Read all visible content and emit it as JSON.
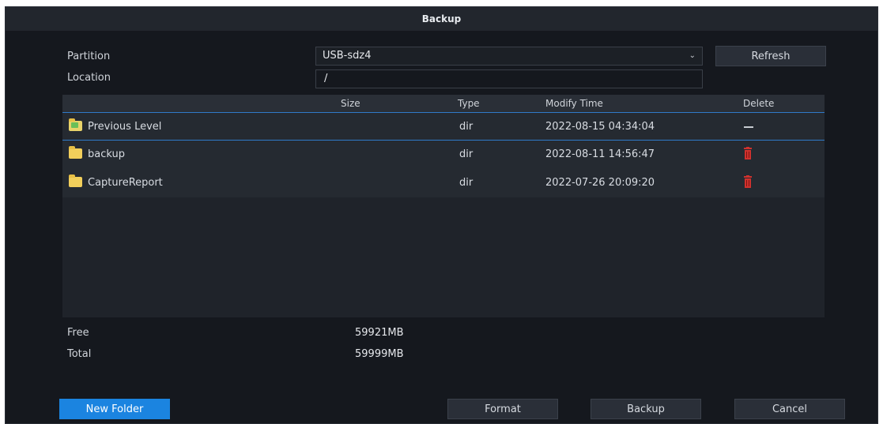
{
  "dialog": {
    "title": "Backup"
  },
  "form": {
    "partition_label": "Partition",
    "partition_value": "USB-sdz4",
    "location_label": "Location",
    "location_value": "/",
    "refresh_label": "Refresh"
  },
  "table": {
    "columns": [
      "Size",
      "Type",
      "Modify Time",
      "Delete"
    ],
    "rows": [
      {
        "name": "Previous Level",
        "size": "",
        "type": "dir",
        "modified": "2022-08-15 04:34:04",
        "delete": "none"
      },
      {
        "name": "backup",
        "size": "",
        "type": "dir",
        "modified": "2022-08-11 14:56:47",
        "delete": "trash-icon"
      },
      {
        "name": "CaptureReport",
        "size": "",
        "type": "dir",
        "modified": "2022-07-26 20:09:20",
        "delete": "trash-icon"
      }
    ]
  },
  "storage": {
    "free_label": "Free",
    "free_value": "59921MB",
    "total_label": "Total",
    "total_value": "59999MB"
  },
  "buttons": {
    "new_folder": "New Folder",
    "format": "Format",
    "backup": "Backup",
    "cancel": "Cancel"
  },
  "colors": {
    "background": "#15181e",
    "accent": "#1b84e0",
    "delete": "#d0312d",
    "selection": "#2f7ac8"
  }
}
